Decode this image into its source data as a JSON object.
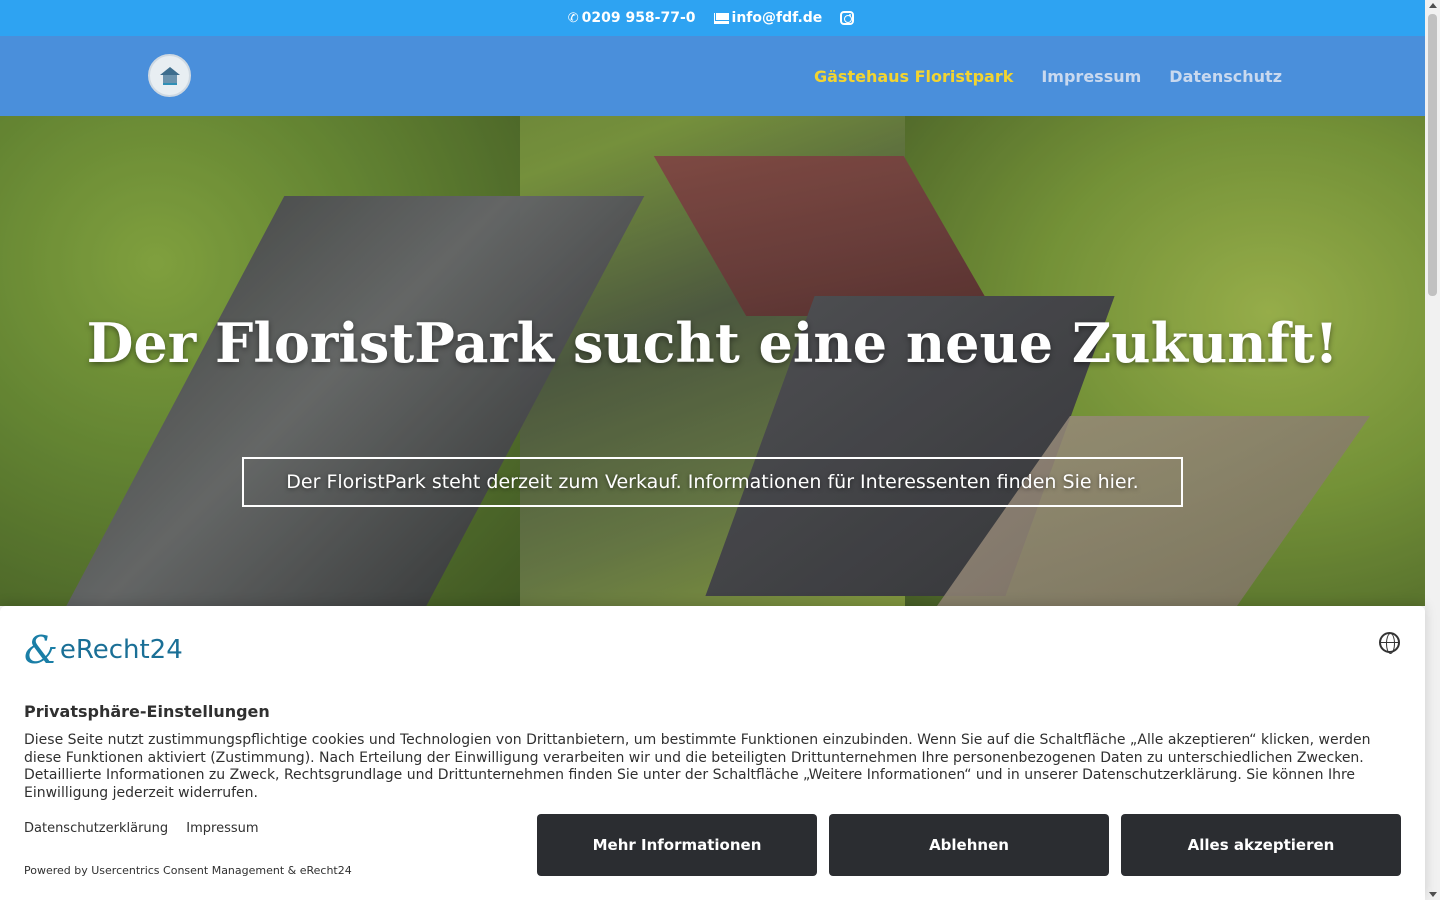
{
  "topbar": {
    "phone": "0209 958-77-0",
    "email": "info@fdf.de",
    "icons": [
      "phone-icon",
      "mail-icon",
      "instagram-icon"
    ]
  },
  "nav": {
    "items": [
      {
        "label": "Gästehaus Floristpark",
        "active": true
      },
      {
        "label": "Impressum",
        "active": false
      },
      {
        "label": "Datenschutz",
        "active": false
      }
    ]
  },
  "hero": {
    "title": "Der FloristPark sucht eine neue Zukunft!",
    "cta": "Der FloristPark steht derzeit zum Verkauf. Informationen für Interessenten finden Sie hier."
  },
  "consent": {
    "logo_mark": "&",
    "logo_text": "eRecht24",
    "title": "Privatsphäre-Einstellungen",
    "text": "Diese Seite nutzt zustimmungspflichtige cookies und Technologien von Drittanbietern, um bestimmte Funktionen einzubinden. Wenn Sie auf die Schaltfläche „Alle akzeptieren“ klicken, werden diese Funktionen aktiviert (Zustimmung). Nach Erteilung der Einwilligung verarbeiten wir und die beteiligten Drittunternehmen Ihre personenbezogenen Daten zu unterschiedlichen Zwecken. Detaillierte Informationen zu Zweck, Rechtsgrundlage und Drittunternehmen finden Sie unter der Schaltfläche „Weitere Informationen“ und in unserer Datenschutzerklärung. Sie können Ihre Einwilligung jederzeit widerrufen.",
    "links": [
      "Datenschutzerklärung",
      "Impressum"
    ],
    "powered_by": "Powered by Usercentrics Consent Management & eRecht24",
    "buttons": {
      "more": "Mehr Informationen",
      "deny": "Ablehnen",
      "accept": "Alles akzeptieren"
    }
  },
  "colors": {
    "topbar": "#2ea3f2",
    "navbar": "#4a8fdb",
    "nav_active": "#f2d431",
    "button_dark": "#2b2d31"
  }
}
